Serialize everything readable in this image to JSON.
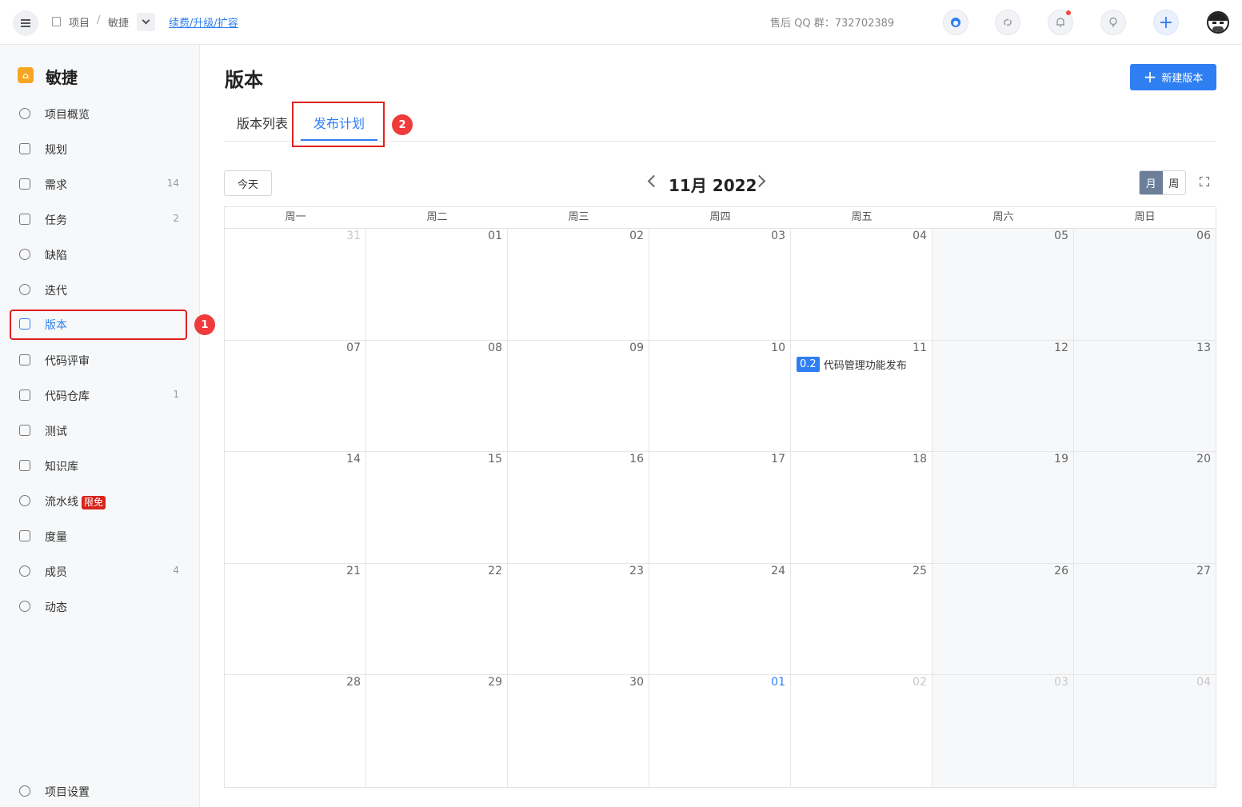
{
  "topbar": {
    "breadcrumb_project": "项目",
    "breadcrumb_separator": "/",
    "breadcrumb_current": "敏捷",
    "renew_link": "续费/升级/扩容",
    "qq_support": "售后 QQ 群：732702389"
  },
  "sidebar": {
    "project_name": "敏捷",
    "items": [
      {
        "label": "项目概览",
        "count": ""
      },
      {
        "label": "规划",
        "count": ""
      },
      {
        "label": "需求",
        "count": "14"
      },
      {
        "label": "任务",
        "count": "2"
      },
      {
        "label": "缺陷",
        "count": ""
      },
      {
        "label": "迭代",
        "count": ""
      },
      {
        "label": "版本",
        "count": ""
      },
      {
        "label": "代码评审",
        "count": ""
      },
      {
        "label": "代码仓库",
        "count": "1"
      },
      {
        "label": "测试",
        "count": ""
      },
      {
        "label": "知识库",
        "count": ""
      },
      {
        "label": "流水线",
        "count": "",
        "badge": "限免"
      },
      {
        "label": "度量",
        "count": ""
      },
      {
        "label": "成员",
        "count": "4"
      },
      {
        "label": "动态",
        "count": ""
      }
    ],
    "settings_label": "项目设置"
  },
  "markers": {
    "first": "1",
    "second": "2"
  },
  "main": {
    "title": "版本",
    "new_button": "新建版本",
    "tabs": [
      {
        "label": "版本列表"
      },
      {
        "label": "发布计划"
      }
    ]
  },
  "calendar": {
    "today_button": "今天",
    "title": "11月 2022",
    "view_month": "月",
    "view_week": "周",
    "weekdays": [
      "周一",
      "周二",
      "周三",
      "周四",
      "周五",
      "周六",
      "周日"
    ],
    "days": [
      "31",
      "01",
      "02",
      "03",
      "04",
      "05",
      "06",
      "07",
      "08",
      "09",
      "10",
      "11",
      "12",
      "13",
      "14",
      "15",
      "16",
      "17",
      "18",
      "19",
      "20",
      "21",
      "22",
      "23",
      "24",
      "25",
      "26",
      "27",
      "28",
      "29",
      "30",
      "01",
      "02",
      "03",
      "04"
    ],
    "event": {
      "tag": "0.2",
      "name": "代码管理功能发布"
    }
  },
  "colors": {
    "accent": "#2f7ff2",
    "highlight_box": "#e02020",
    "marker": "#ef3b3b",
    "badge": "#d8231c"
  }
}
